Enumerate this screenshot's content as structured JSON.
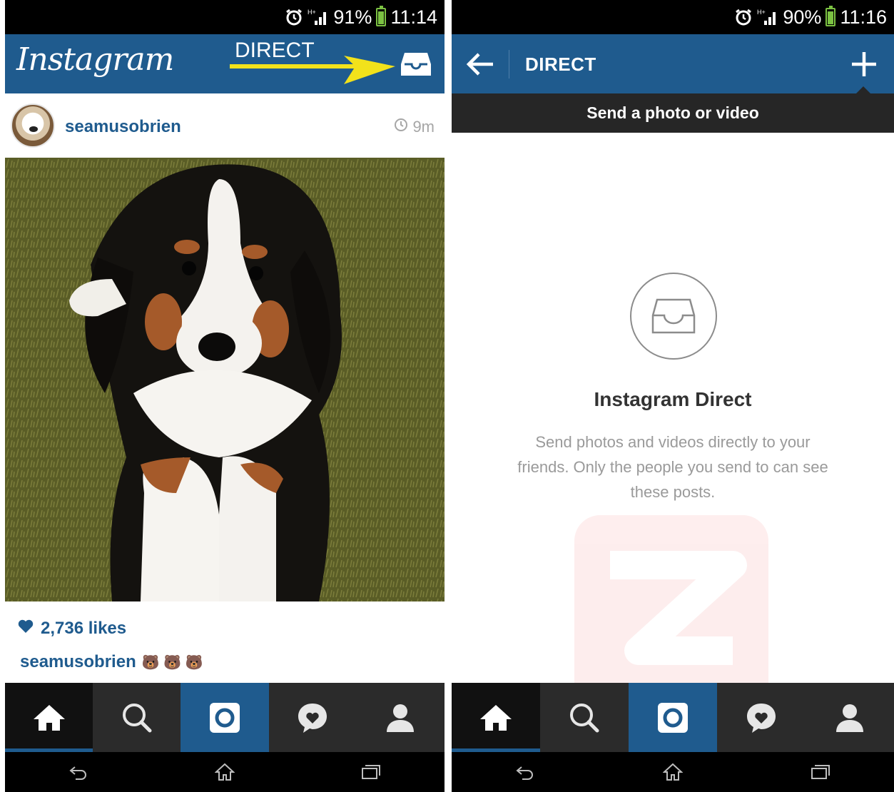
{
  "left": {
    "status": {
      "battery": "91%",
      "time": "11:14"
    },
    "header": {
      "logo": "Instagram",
      "annotation": "DIRECT"
    },
    "post": {
      "username": "seamusobrien",
      "time": "9m",
      "likes": "2,736 likes",
      "caption_user": "seamusobrien",
      "caption_emoji": "🐻 🐻 🐻"
    },
    "tabs": [
      "home",
      "search",
      "camera",
      "activity",
      "profile"
    ]
  },
  "right": {
    "status": {
      "battery": "90%",
      "time": "11:16"
    },
    "header": {
      "title": "DIRECT"
    },
    "tooltip": "Send a photo or video",
    "empty": {
      "title": "Instagram Direct",
      "description": "Send photos and videos directly to your friends. Only the people you send to can see these posts."
    },
    "tabs": [
      "home",
      "search",
      "camera",
      "activity",
      "profile"
    ]
  },
  "colors": {
    "brand": "#1f5b8e",
    "annotation_arrow": "#f2e21b",
    "battery": "#7bc142"
  },
  "icons": [
    "alarm-icon",
    "signal-icon",
    "battery-icon",
    "inbox-icon",
    "clock-icon",
    "heart-icon",
    "back-arrow-icon",
    "plus-icon",
    "home-icon",
    "search-icon",
    "camera-icon",
    "activity-icon",
    "profile-icon",
    "nav-back-icon",
    "nav-home-icon",
    "nav-recents-icon"
  ]
}
